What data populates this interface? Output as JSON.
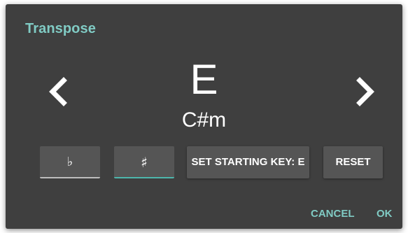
{
  "dialog": {
    "title": "Transpose",
    "key_major": "E",
    "key_minor": "C#m",
    "prev_icon": "chevron-left-icon",
    "next_icon": "chevron-right-icon",
    "flat_label": "♭",
    "sharp_label": "♯",
    "set_starting_key_label": "SET STARTING KEY: E",
    "reset_label": "RESET",
    "cancel_label": "CANCEL",
    "ok_label": "OK"
  },
  "colors": {
    "background": "#3f3f3f",
    "accent": "#80cbc4",
    "button": "#555555",
    "text": "#ffffff"
  }
}
